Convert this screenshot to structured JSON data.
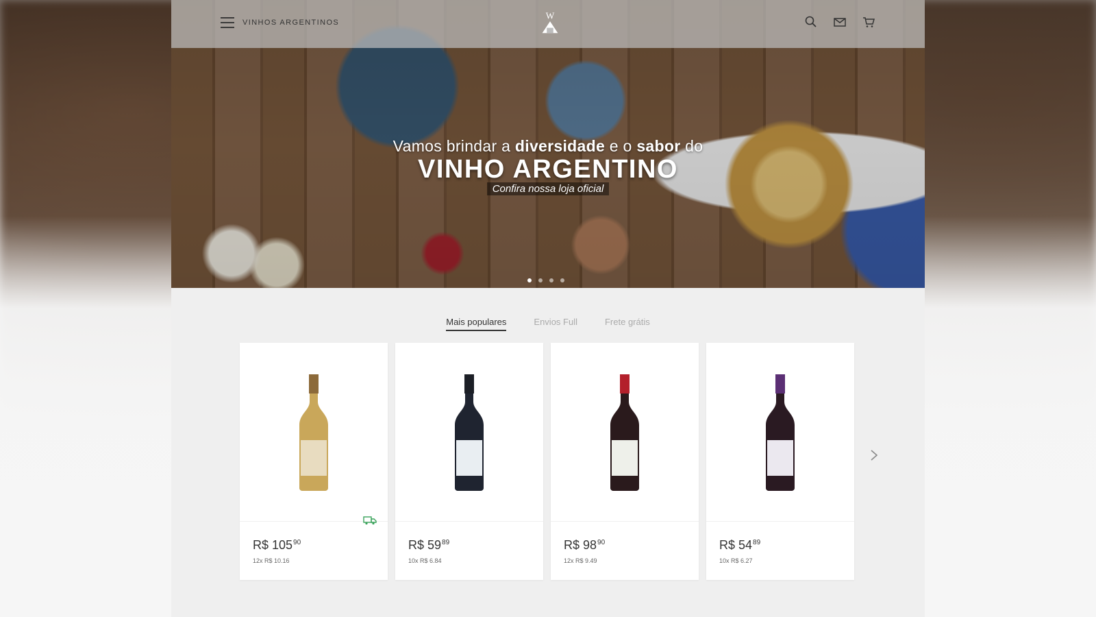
{
  "header": {
    "brand_name": "VINHOS ARGENTINOS",
    "menu_icon": "hamburger-menu-icon",
    "logo_icon": "wine-store-logo-icon",
    "icons": [
      "search-icon",
      "mail-icon",
      "cart-icon"
    ]
  },
  "hero": {
    "line1_a": "Vamos brindar a ",
    "line1_b": "diversidade",
    "line1_c": " e o ",
    "line1_d": "sabor",
    "line1_e": " do",
    "line2": "VINHO ARGENTINO",
    "line3": "Confira nossa loja oficial",
    "slides": 4,
    "active_slide": 0
  },
  "tabs": [
    {
      "label": "Mais populares",
      "active": true
    },
    {
      "label": "Envios Full",
      "active": false
    },
    {
      "label": "Frete grátis",
      "active": false
    }
  ],
  "products": [
    {
      "price_int": "R$ 105",
      "price_cents": "90",
      "installment": "12x R$ 10.16",
      "bottle_color": "#c9a75a",
      "label_color": "#e8dcc0",
      "cap_color": "#8c6a3a",
      "free_shipping": true
    },
    {
      "price_int": "R$ 59",
      "price_cents": "89",
      "installment": "10x R$ 6.84",
      "bottle_color": "#1f2430",
      "label_color": "#e9eef2",
      "cap_color": "#1c1f26",
      "free_shipping": false
    },
    {
      "price_int": "R$ 98",
      "price_cents": "90",
      "installment": "12x R$ 9.49",
      "bottle_color": "#2a1a1c",
      "label_color": "#eef0ea",
      "cap_color": "#b3202b",
      "free_shipping": false
    },
    {
      "price_int": "R$ 54",
      "price_cents": "89",
      "installment": "10x R$ 6.27",
      "bottle_color": "#2a1a22",
      "label_color": "#ebe8ef",
      "cap_color": "#5b2f74",
      "free_shipping": false
    }
  ],
  "colors": {
    "shipping_green": "#3aa35b",
    "text_dark": "#333333",
    "tab_inactive": "#aaaaaa"
  }
}
